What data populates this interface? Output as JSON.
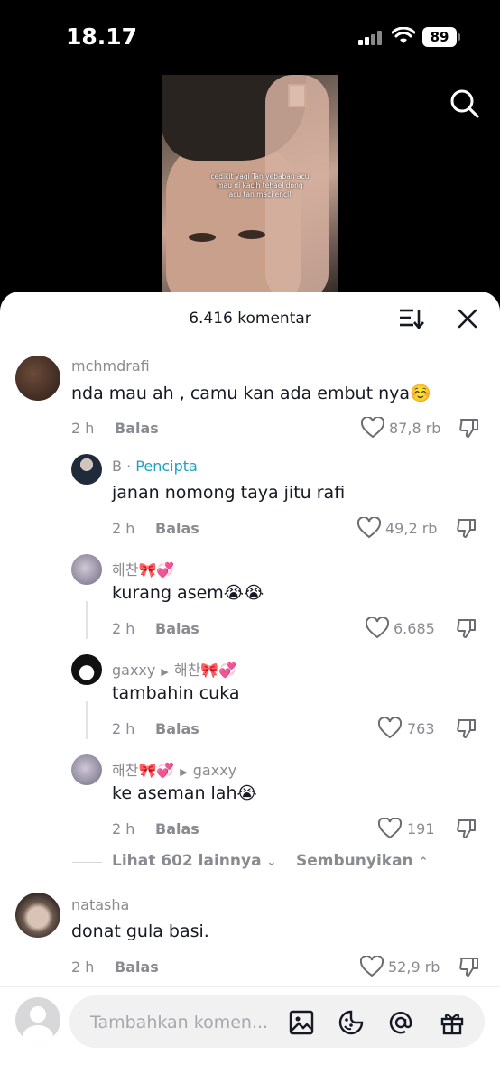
{
  "status": {
    "time": "18.17",
    "battery": "89"
  },
  "video": {
    "overlay_text": "cedikit yagi Tan yebaban acu mau di kacih tehael dong acu tan maci encil"
  },
  "sheet": {
    "count_label": "6.416 komentar"
  },
  "comments": [
    {
      "user": "mchmdrafi",
      "text": "nda mau ah , camu kan ada embut nya☺️",
      "time": "2 h",
      "reply": "Balas",
      "likes": "87,8 rb"
    },
    {
      "user": "B",
      "sep": "·",
      "creator": "Pencipta",
      "text": "janan nomong taya jitu rafi",
      "time": "2 h",
      "reply": "Balas",
      "likes": "49,2 rb"
    },
    {
      "user": "해찬🎀💞",
      "text": "kurang asem😭😭",
      "time": "2 h",
      "reply": "Balas",
      "likes": "6.685"
    },
    {
      "user": "gaxxy",
      "reply_to": "해찬🎀💞",
      "text": "tambahin cuka",
      "time": "2 h",
      "reply": "Balas",
      "likes": "763"
    },
    {
      "user": "해찬🎀💞",
      "reply_to": "gaxxy",
      "text": "ke aseman lah😭",
      "time": "2 h",
      "reply": "Balas",
      "likes": "191"
    },
    {
      "user": "natasha",
      "text": "donat gula basi.",
      "time": "2 h",
      "reply": "Balas",
      "likes": "52,9 rb"
    }
  ],
  "thread": {
    "more_label": "Lihat 602 lainnya",
    "hide_label": "Sembunyikan"
  },
  "input": {
    "placeholder": "Tambahkan komen..."
  },
  "icons": [
    "search-icon",
    "sort-icon",
    "close-icon",
    "heart-icon",
    "dislike-icon",
    "image-icon",
    "sticker-icon",
    "mention-icon",
    "gift-icon"
  ],
  "colors": {
    "creator": "#1ea1c2",
    "text": "#161823",
    "muted": "#8a8b91"
  }
}
